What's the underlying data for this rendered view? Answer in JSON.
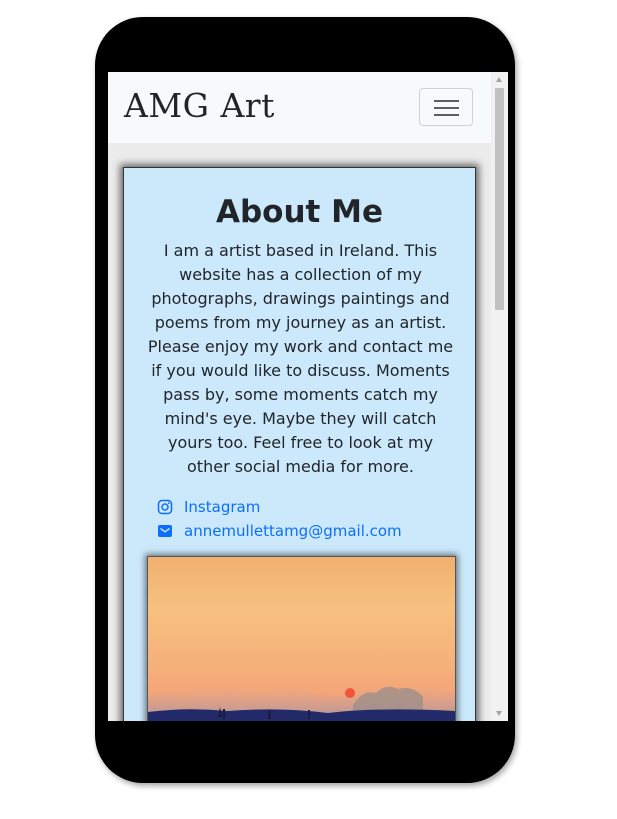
{
  "navbar": {
    "brand": "AMG Art",
    "toggler_icon": "hamburger-icon"
  },
  "about": {
    "title": "About Me",
    "text": "I am a artist based in Ireland. This website has a collection of my photographs, drawings paintings and poems from my journey as an artist. Please enjoy my work and contact me if you would like to discuss. Moments pass by, some moments catch my mind's eye. Maybe they will catch yours too. Feel free to look at my other social media for more."
  },
  "links": [
    {
      "icon": "instagram-icon",
      "label": "Instagram"
    },
    {
      "icon": "envelope-icon",
      "label": "annemullettamg@gmail.com"
    }
  ],
  "colors": {
    "card_bg": "#cce9fc",
    "link": "#0d6efd",
    "navbar_bg": "#f8f9fa"
  }
}
